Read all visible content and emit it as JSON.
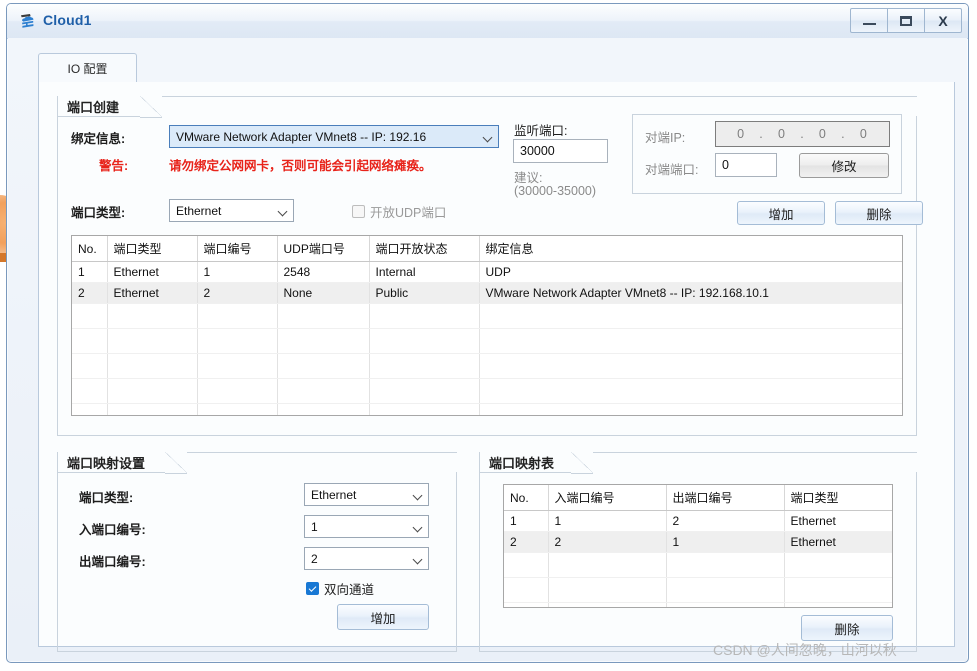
{
  "window": {
    "title": "Cloud1",
    "icon": "cloud-network-icon",
    "controls": {
      "minimize": "minimize-icon",
      "maximize": "maximize-icon",
      "close": "X"
    }
  },
  "tabs": [
    {
      "label": "IO 配置",
      "active": true
    }
  ],
  "port_create": {
    "title": "端口创建",
    "binding_label": "绑定信息:",
    "binding_value": "VMware Network Adapter VMnet8 -- IP: 192.16",
    "warning_key": "警告:",
    "warning_text": "请勿绑定公网网卡，否则可能会引起网络瘫痪。",
    "port_type_label": "端口类型:",
    "port_type_value": "Ethernet",
    "udp_checkbox_label": "开放UDP端口",
    "udp_checked": false,
    "listen_port_label": "监听端口:",
    "listen_port_value": "30000",
    "suggest_label": "建议:",
    "suggest_range": "(30000-35000)",
    "peer_ip_label": "对端IP:",
    "peer_ip_octets": [
      "0",
      "0",
      "0",
      "0"
    ],
    "peer_port_label": "对端端口:",
    "peer_port_value": "0",
    "modify_button": "修改",
    "add_button": "增加",
    "delete_button": "删除"
  },
  "port_table": {
    "columns": [
      "No.",
      "端口类型",
      "端口编号",
      "UDP端口号",
      "端口开放状态",
      "绑定信息"
    ],
    "rows": [
      {
        "no": "1",
        "type": "Ethernet",
        "number": "1",
        "udp": "2548",
        "state": "Internal",
        "binding": "UDP",
        "selected": false
      },
      {
        "no": "2",
        "type": "Ethernet",
        "number": "2",
        "udp": "None",
        "state": "Public",
        "binding": "VMware Network Adapter VMnet8 -- IP: 192.168.10.1",
        "selected": true
      }
    ],
    "empty_row_count": 4
  },
  "mapping_settings": {
    "title": "端口映射设置",
    "port_type_label": "端口类型:",
    "port_type_value": "Ethernet",
    "in_port_label": "入端口编号:",
    "in_port_value": "1",
    "out_port_label": "出端口编号:",
    "out_port_value": "2",
    "bidirectional_label": "双向通道",
    "bidirectional_checked": true,
    "add_button": "增加"
  },
  "mapping_table": {
    "title": "端口映射表",
    "columns": [
      "No.",
      "入端口编号",
      "出端口编号",
      "端口类型"
    ],
    "rows": [
      {
        "no": "1",
        "in": "1",
        "out": "2",
        "type": "Ethernet",
        "selected": false
      },
      {
        "no": "2",
        "in": "2",
        "out": "1",
        "type": "Ethernet",
        "selected": true
      }
    ],
    "empty_row_count": 3,
    "delete_button": "删除"
  },
  "watermark": "CSDN @人间忽晚，山河以秋",
  "colors": {
    "accent": "#1f5fa8",
    "warning": "#e8231a",
    "checkbox_on": "#1878d4"
  }
}
